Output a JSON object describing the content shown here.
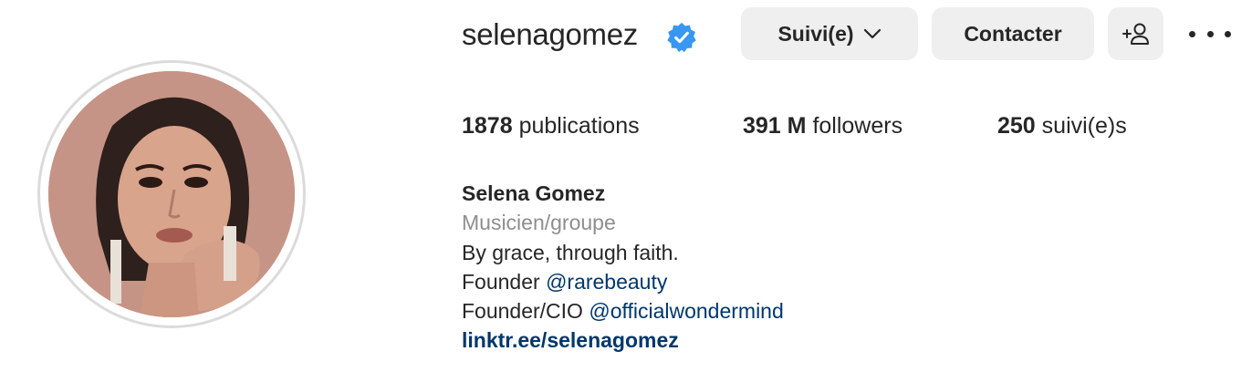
{
  "profile": {
    "username": "selenagomez",
    "verified": true,
    "full_name": "Selena Gomez",
    "category": "Musicien/groupe",
    "bio_line1": "By grace, through faith.",
    "bio_line2_prefix": "Founder ",
    "bio_line2_mention": "@rarebeauty",
    "bio_line3_prefix": "Founder/CIO ",
    "bio_line3_mention": "@officialwondermind",
    "link": "linktr.ee/selenagomez"
  },
  "actions": {
    "follow_label": "Suivi(e)",
    "contact_label": "Contacter"
  },
  "stats": {
    "posts_count": "1878",
    "posts_label": "publications",
    "followers_count": "391 M",
    "followers_label": "followers",
    "following_count": "250",
    "following_label": "suivi(e)s"
  },
  "colors": {
    "verified_badge": "#3897f0",
    "button_bg": "#efefef",
    "link": "#00376b",
    "secondary_text": "#8e8e8e"
  },
  "icons": {
    "verified": "verified-badge-icon",
    "dropdown": "chevron-down-icon",
    "add_user": "add-user-icon",
    "more": "more-options-icon"
  }
}
